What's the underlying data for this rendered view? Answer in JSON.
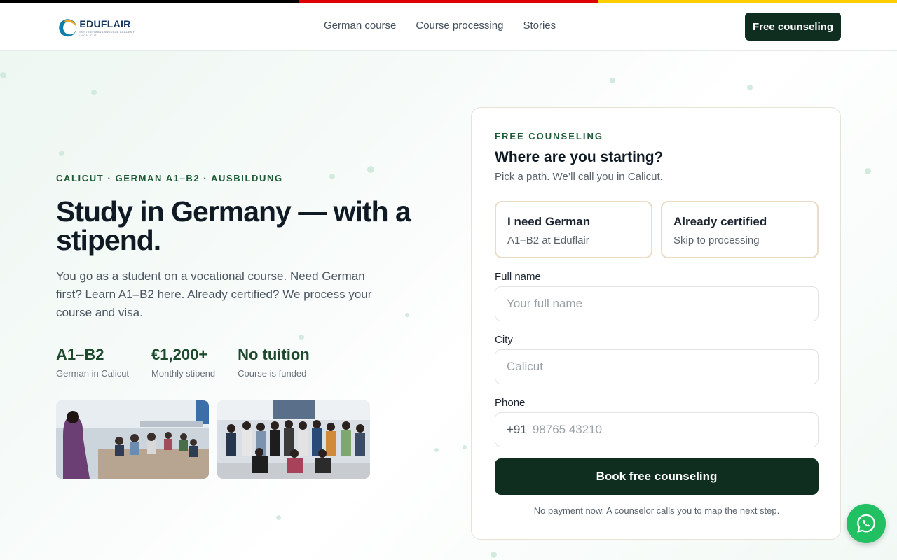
{
  "brand": {
    "name": "EDUFLAIR",
    "tagline": "BEST GERMAN LANGUAGE ACADEMY IN CALICUT",
    "flag_colors": [
      "#000000",
      "#dd0000",
      "#ffce00"
    ]
  },
  "nav": {
    "items": [
      {
        "label": "German course"
      },
      {
        "label": "Course processing"
      },
      {
        "label": "Stories"
      }
    ],
    "cta_label": "Free counseling"
  },
  "hero": {
    "eyebrow": "CALICUT · GERMAN A1–B2 · AUSBILDUNG",
    "headline": "Study in Germany — with a stipend.",
    "lede": "You go as a student on a vocational course. Need German first? Learn A1–B2 here. Already certified? We process your course and visa.",
    "stats": [
      {
        "value": "A1–B2",
        "label": "German in Calicut"
      },
      {
        "value": "€1,200+",
        "label": "Monthly stipend"
      },
      {
        "value": "No tuition",
        "label": "Course is funded"
      }
    ]
  },
  "form": {
    "eyebrow": "FREE COUNSELING",
    "title": "Where are you starting?",
    "subtitle": "Pick a path. We’ll call you in Calicut.",
    "choices": [
      {
        "title": "I need German",
        "subtitle": "A1–B2 at Eduflair"
      },
      {
        "title": "Already certified",
        "subtitle": "Skip to processing"
      }
    ],
    "fields": {
      "name": {
        "label": "Full name",
        "placeholder": "Your full name"
      },
      "city": {
        "label": "City",
        "placeholder": "Calicut"
      },
      "phone": {
        "label": "Phone",
        "prefix": "+91",
        "placeholder": "98765 43210"
      }
    },
    "submit_label": "Book free counseling",
    "footnote": "No payment now. A counselor calls you to map the next step."
  },
  "floating": {
    "whatsapp_icon": "whatsapp-icon",
    "accent": "#21c062"
  },
  "colors": {
    "primary": "#0f2e1f",
    "eyebrow": "#1d5a36",
    "choice_border": "#ebdcc8"
  }
}
